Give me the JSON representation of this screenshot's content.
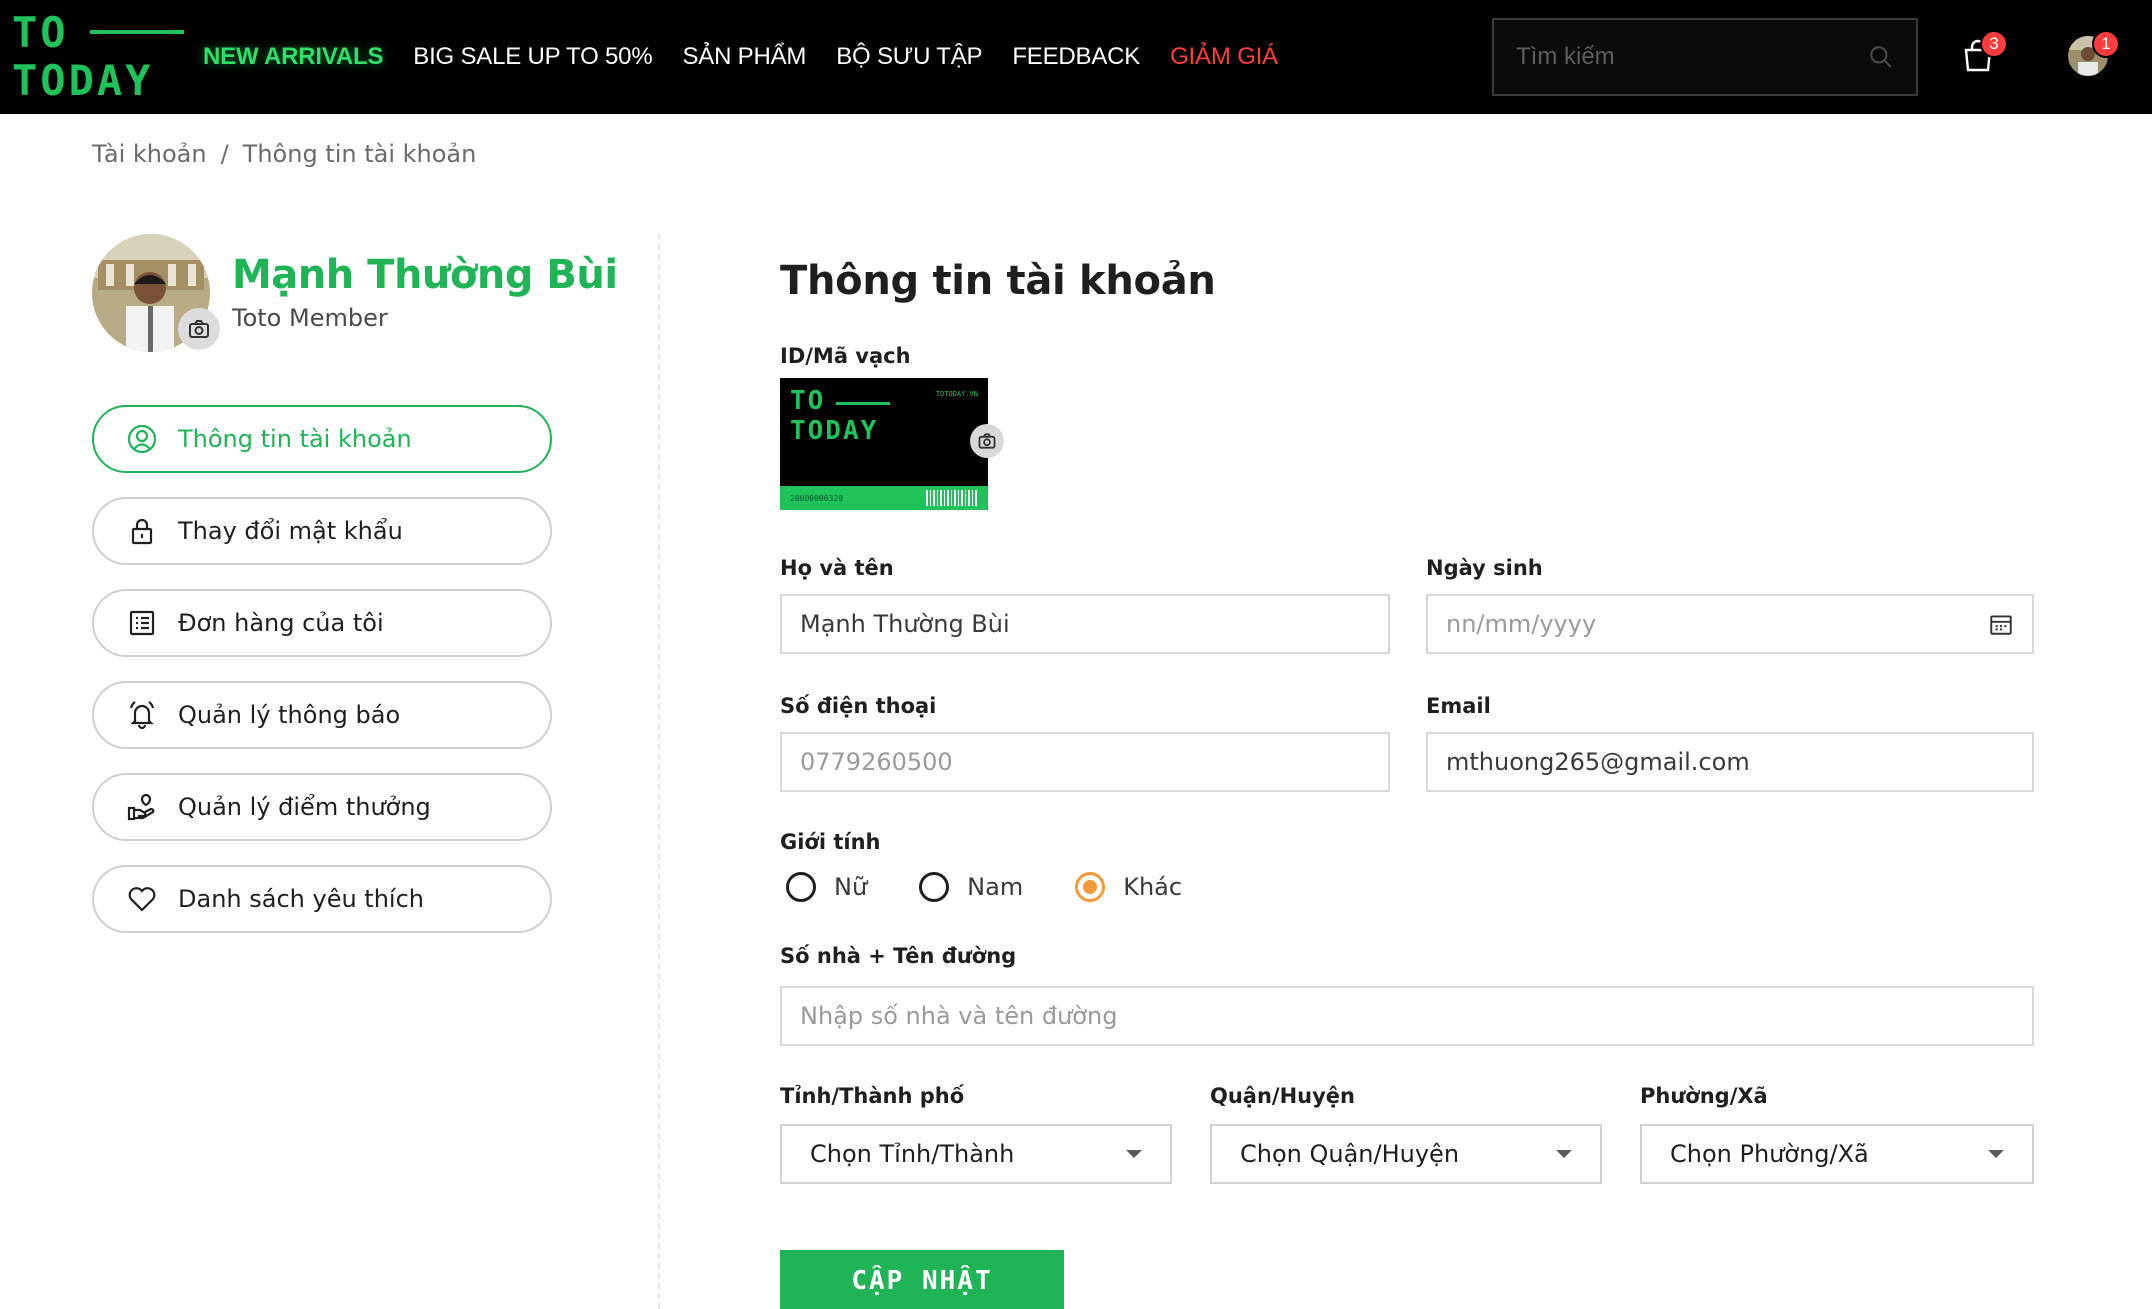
{
  "header": {
    "logo": {
      "line1": "TO",
      "line2": "TODAY"
    },
    "nav": [
      "NEW ARRIVALS",
      "BIG SALE UP TO 50%",
      "SẢN PHẨM",
      "BỘ SƯU TẬP",
      "FEEDBACK",
      "GIẢM GIÁ"
    ],
    "search_placeholder": "Tìm kiếm",
    "cart_count": "3",
    "notification_count": "1"
  },
  "breadcrumb": {
    "root": "Tài khoản",
    "separator": "/",
    "current": "Thông tin tài khoản"
  },
  "profile": {
    "name": "Mạnh Thường Bùi",
    "tier": "Toto Member"
  },
  "menu": [
    {
      "label": "Thông tin tài khoản",
      "icon": "user-circle-icon"
    },
    {
      "label": "Thay đổi mật khẩu",
      "icon": "lock-icon"
    },
    {
      "label": "Đơn hàng của tôi",
      "icon": "order-list-icon"
    },
    {
      "label": "Quản lý thông báo",
      "icon": "bell-icon"
    },
    {
      "label": "Quản lý điểm thưởng",
      "icon": "reward-icon"
    },
    {
      "label": "Danh sách yêu thích",
      "icon": "heart-icon"
    }
  ],
  "main": {
    "title": "Thông tin tài khoản",
    "id_label": "ID/Mã vạch",
    "card": {
      "line1": "TO",
      "line2": "TODAY",
      "brand_small": "TOTODAY.VN",
      "number": "20000000320"
    },
    "fullname_label": "Họ và tên",
    "fullname_value": "Mạnh Thường Bùi",
    "dob_label": "Ngày sinh",
    "dob_placeholder": "nn/mm/yyyy",
    "phone_label": "Số điện thoại",
    "phone_placeholder": "0779260500",
    "email_label": "Email",
    "email_value": "mthuong265@gmail.com",
    "gender_label": "Giới tính",
    "gender_options": [
      "Nữ",
      "Nam",
      "Khác"
    ],
    "gender_selected": "Khác",
    "address_label": "Số nhà + Tên đường",
    "address_placeholder": "Nhập số nhà và tên đường",
    "province_label": "Tỉnh/Thành phố",
    "province_value": "Chọn Tỉnh/Thành",
    "district_label": "Quận/Huyện",
    "district_value": "Chọn Quận/Huyện",
    "ward_label": "Phường/Xã",
    "ward_value": "Chọn Phường/Xã",
    "submit_label": "CẬP NHẬT"
  },
  "colors": {
    "brand_green": "#1fb455",
    "accent_orange": "#f59a3a",
    "sale_red": "#ff3b3b",
    "header_bg": "#000000"
  }
}
